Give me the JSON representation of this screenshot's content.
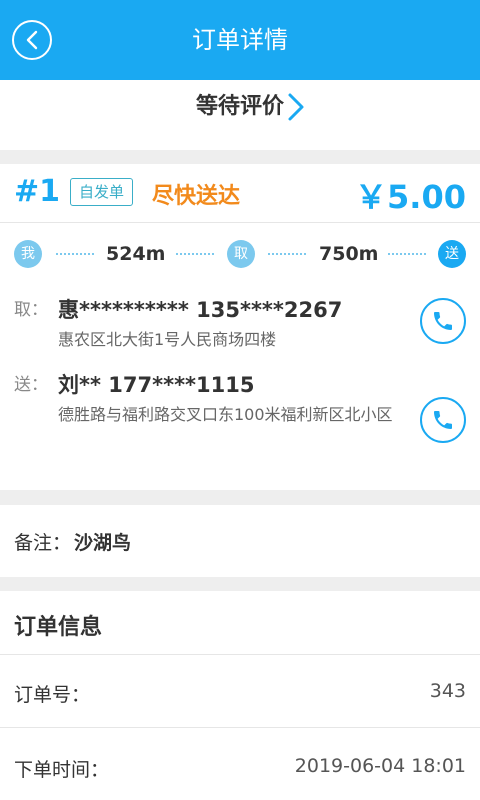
{
  "header": {
    "title": "订单详情",
    "back_icon": "chevron-left-icon"
  },
  "status": {
    "label": "等待评价",
    "icon": "chevron-right-icon"
  },
  "order": {
    "number": "#1",
    "tag": "自发单",
    "urgency": "尽快送达",
    "price": "￥5.00",
    "route": {
      "me_label": "我",
      "pickup_node_label": "取",
      "delivery_node_label": "送",
      "dist_to_pickup": "524m",
      "dist_to_delivery": "750m"
    },
    "pickup": {
      "label": "取：",
      "contact": "惠********** 135****2267",
      "address": "惠农区北大街1号人民商场四楼",
      "phone_icon": "phone-icon"
    },
    "delivery": {
      "label": "送：",
      "contact": "刘** 177****1115",
      "address": "德胜路与福利路交叉口东100米福利新区北小区",
      "phone_icon": "phone-icon"
    }
  },
  "note": {
    "label": "备注：",
    "value": "沙湖鸟"
  },
  "info": {
    "title": "订单信息",
    "rows": [
      {
        "key": "订单号：",
        "value": "343"
      },
      {
        "key": "下单时间：",
        "value": "2019-06-04 18:01"
      }
    ]
  },
  "colors": {
    "accent": "#1aa9f2",
    "urgent": "#f28a1c",
    "background": "#eeeeee"
  }
}
